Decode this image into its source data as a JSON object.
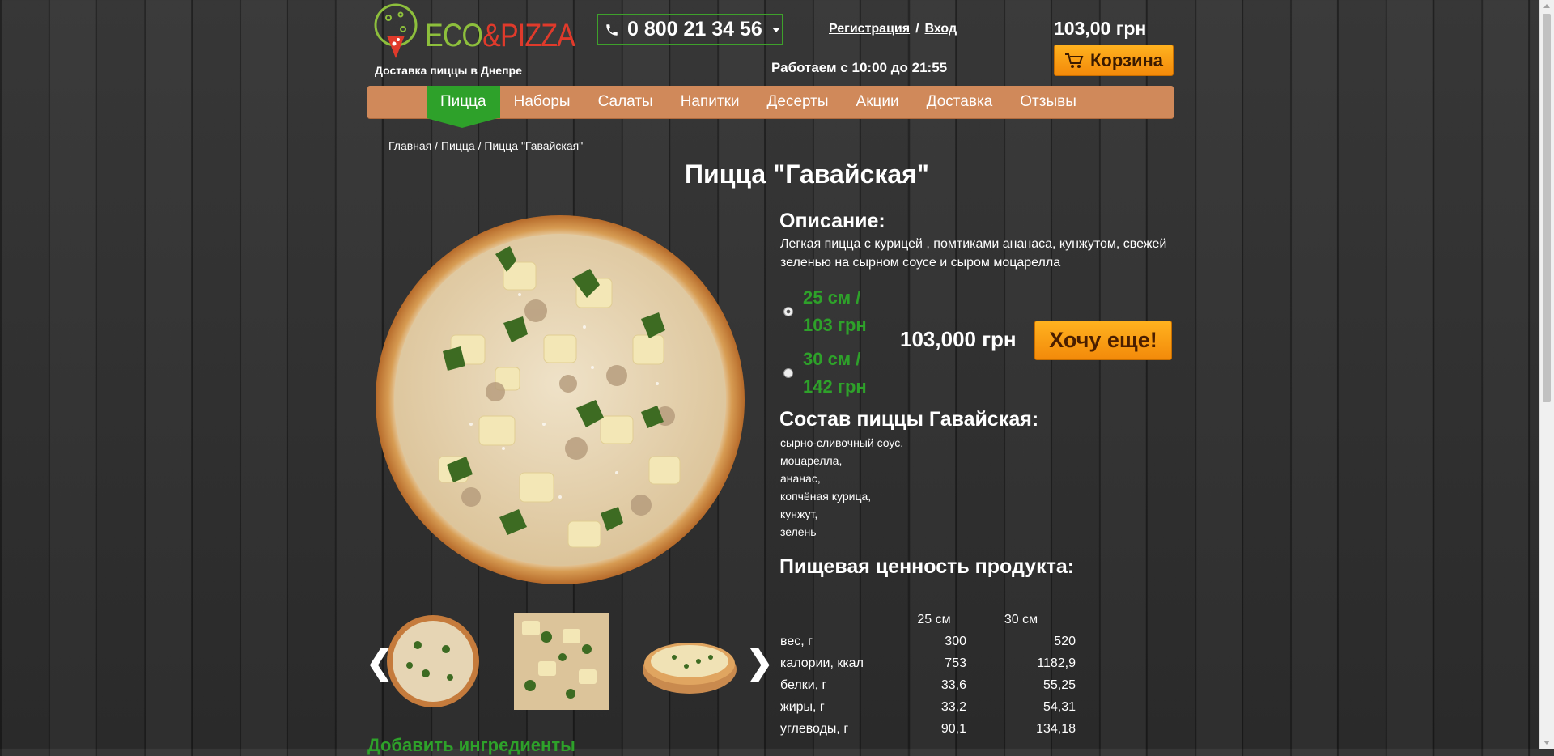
{
  "header": {
    "logo_eco": "ECO",
    "logo_amp": "&",
    "logo_pizza": "PIZZA",
    "tagline": "Доставка пиццы в Днепре",
    "phone": "0 800 21 34 56",
    "register": "Регистрация",
    "auth_sep": "/",
    "login": "Вход",
    "hours": "Работаем с 10:00 до 21:55",
    "cart_total": "103,00 грн",
    "cart_label": "Корзина"
  },
  "nav": {
    "items": [
      "Пицца",
      "Наборы",
      "Салаты",
      "Напитки",
      "Десерты",
      "Акции",
      "Доставка",
      "Отзывы"
    ],
    "active": "Пицца"
  },
  "breadcrumb": {
    "home": "Главная",
    "sep": " / ",
    "category": "Пицца",
    "current": "Пицца \"Гавайская\""
  },
  "product": {
    "title": "Пицца \"Гавайская\"",
    "description_heading": "Описание:",
    "description": "Легкая пицца с курицей , помтиками ананаса, кунжутом, свежей зеленью на сырном соусе и сыром  моцарелла",
    "sizes": [
      {
        "line1": "25 см /",
        "line2": "103 грн",
        "selected": true
      },
      {
        "line1": "30 см /",
        "line2": "142 грн",
        "selected": false
      }
    ],
    "price": "103,000 грн",
    "buy_button": "Хочу еще!",
    "composition_heading": "Состав пиццы Гавайская:",
    "composition": [
      "сырно-сливочный соус,",
      "моцарелла,",
      "ананас,",
      "копчёная курица,",
      "кунжут,",
      "зелень"
    ],
    "nutrition_heading": "Пищевая ценность продукта:",
    "nutrition_columns": [
      "25 см",
      "30 см"
    ],
    "nutrition_rows": [
      {
        "name": "вес, г",
        "v1": "300",
        "v2": "520"
      },
      {
        "name": "калории, ккал",
        "v1": "753",
        "v2": "1182,9"
      },
      {
        "name": "белки, г",
        "v1": "33,6",
        "v2": "55,25"
      },
      {
        "name": "жиры, г",
        "v1": "33,2",
        "v2": "54,31"
      },
      {
        "name": "углеводы, г",
        "v1": "90,1",
        "v2": "134,18"
      }
    ]
  },
  "gallery": {
    "prev": "❮",
    "next": "❯"
  },
  "extras_heading": "Добавить ингредиенты",
  "colors": {
    "nav_bg": "#d0895a",
    "active_green": "#2ea12a",
    "button_orange": "#f38a0a"
  }
}
